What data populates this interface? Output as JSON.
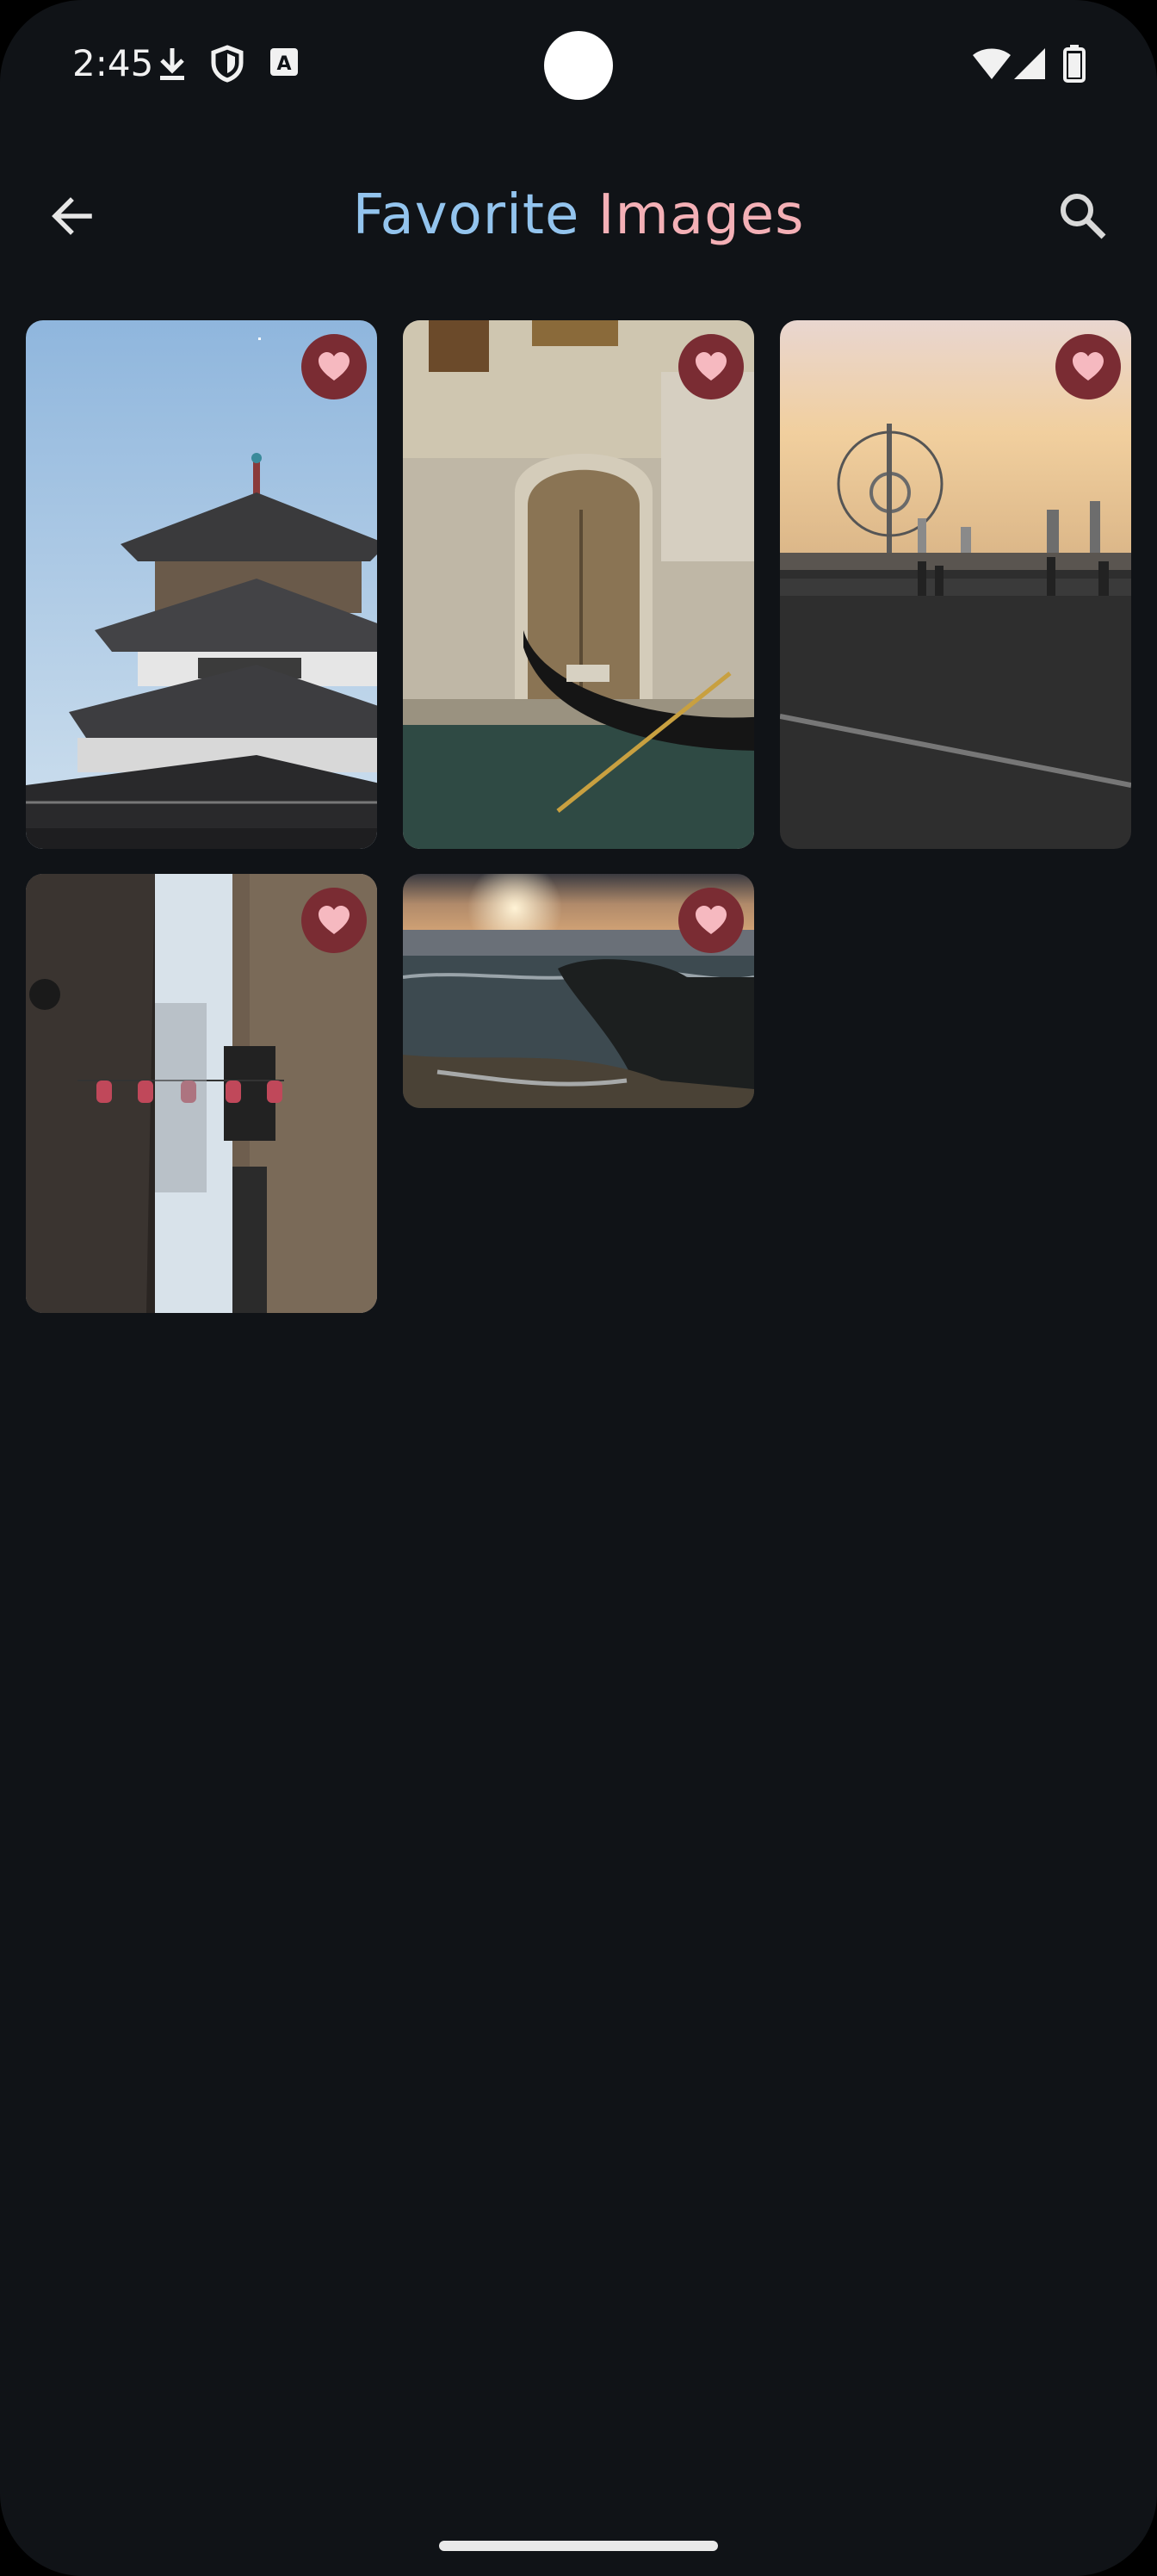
{
  "status_bar": {
    "time": "2:45",
    "left_icons": [
      "download-icon",
      "shield-icon",
      "keyboard-a-icon"
    ],
    "right_icons": [
      "wifi-icon",
      "signal-icon",
      "battery-icon"
    ]
  },
  "app_bar": {
    "title_part1": "Favorite",
    "title_part2": "Images",
    "title_color1": "#93c4ee",
    "title_color2": "#f4b0b6",
    "back_icon": "arrow-back-icon",
    "search_icon": "search-icon"
  },
  "colors": {
    "background": "#101317",
    "favorite_badge": "#7a2c33",
    "favorite_heart": "#f6b9c0"
  },
  "images": [
    {
      "subject": "pagoda",
      "favorited": true
    },
    {
      "subject": "venice-gondola",
      "favorited": true
    },
    {
      "subject": "london-eye-bridge",
      "favorited": true
    },
    {
      "subject": "alley-lanterns",
      "favorited": true
    },
    {
      "subject": "ocean-sunset",
      "favorited": true
    }
  ]
}
